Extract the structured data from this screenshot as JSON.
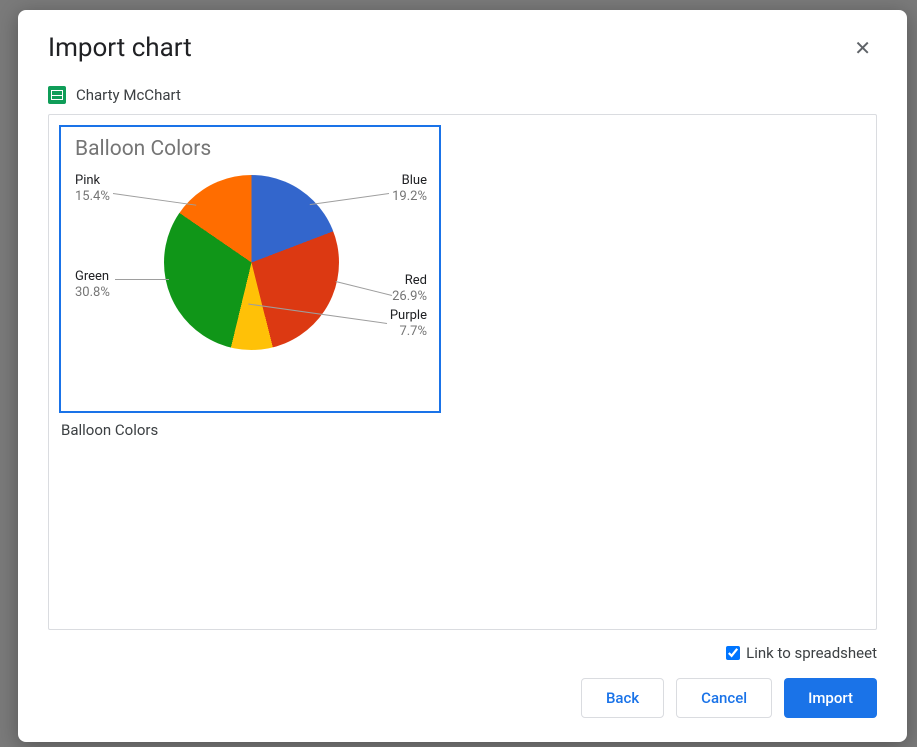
{
  "dialog": {
    "title": "Import chart",
    "source_name": "Charty McChart"
  },
  "chart_thumbnail": {
    "title": "Balloon Colors",
    "caption": "Balloon Colors",
    "labels": {
      "pink": {
        "name": "Pink",
        "pct": "15.4%"
      },
      "blue": {
        "name": "Blue",
        "pct": "19.2%"
      },
      "green": {
        "name": "Green",
        "pct": "30.8%"
      },
      "red": {
        "name": "Red",
        "pct": "26.9%"
      },
      "purple": {
        "name": "Purple",
        "pct": "7.7%"
      }
    }
  },
  "options": {
    "link_label": "Link to spreadsheet",
    "link_checked": true
  },
  "buttons": {
    "back": "Back",
    "cancel": "Cancel",
    "import": "Import"
  },
  "chart_data": {
    "type": "pie",
    "title": "Balloon Colors",
    "categories": [
      "Blue",
      "Red",
      "Purple",
      "Green",
      "Pink"
    ],
    "values": [
      19.2,
      26.9,
      7.7,
      30.8,
      15.4
    ],
    "colors": [
      "#3366cc",
      "#dc3912",
      "#ffc107",
      "#109618",
      "#ff6d00"
    ]
  }
}
